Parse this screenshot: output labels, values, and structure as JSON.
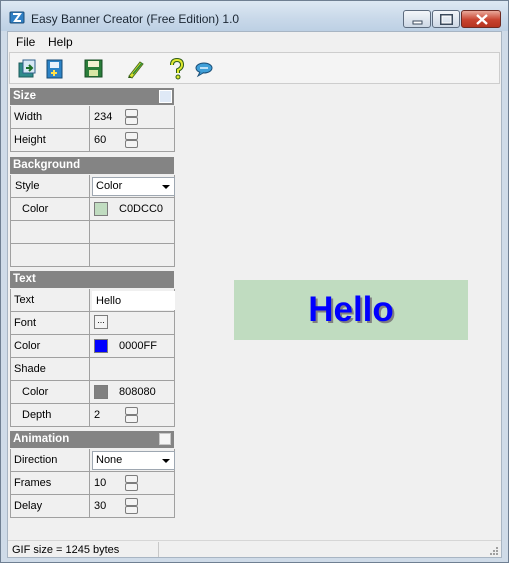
{
  "window": {
    "title": "Easy Banner Creator (Free Edition) 1.0",
    "icons": {
      "app": "banner-app-icon",
      "minimize": "minimize-icon",
      "maximize": "maximize-icon",
      "close": "close-icon"
    }
  },
  "menu": {
    "items": [
      "File",
      "Help"
    ]
  },
  "toolbar": {
    "buttons": [
      "open-icon",
      "new-icon",
      "save-icon",
      "edit-icon",
      "help-icon",
      "chat-icon"
    ]
  },
  "size": {
    "header": "Size",
    "width_label": "Width",
    "width_value": "234",
    "height_label": "Height",
    "height_value": "60"
  },
  "background": {
    "header": "Background",
    "style_label": "Style",
    "style_value": "Color",
    "color_label": "Color",
    "color_hex": "C0DCC0",
    "color": "#C0DCC0"
  },
  "text": {
    "header": "Text",
    "text_label": "Text",
    "text_value": "Hello",
    "font_label": "Font",
    "font_button": "...",
    "color_label": "Color",
    "color_hex": "0000FF",
    "color": "#0000FF",
    "shade_label": "Shade",
    "shade_color_label": "Color",
    "shade_color_hex": "808080",
    "shade_color": "#808080",
    "depth_label": "Depth",
    "depth_value": "2"
  },
  "animation": {
    "header": "Animation",
    "direction_label": "Direction",
    "direction_value": "None",
    "frames_label": "Frames",
    "frames_value": "10",
    "delay_label": "Delay",
    "delay_value": "30"
  },
  "preview": {
    "text": "Hello"
  },
  "status": {
    "text": "GIF size = 1245 bytes"
  }
}
